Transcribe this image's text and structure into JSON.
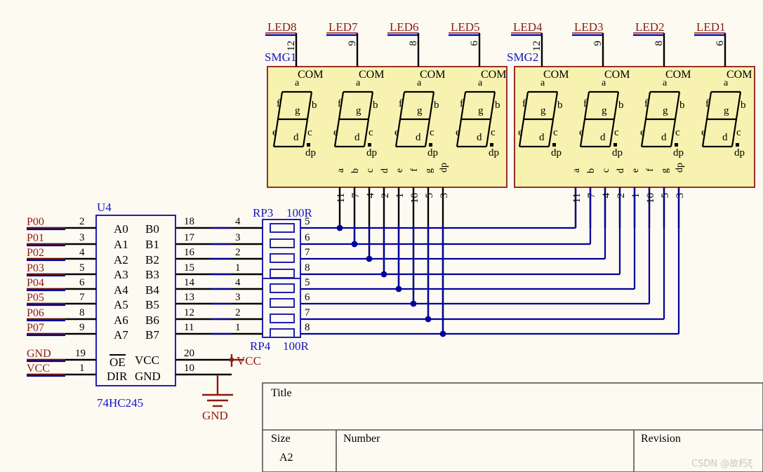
{
  "sheet": {
    "background": "#fdfaf2",
    "wire_color": "#00009f",
    "pin_color": "#000000",
    "net_label_color": "#8b1a10",
    "designator_color": "#1414c8",
    "display_fill": "#f7f2b0",
    "display_border": "#8b1a10"
  },
  "displays": [
    {
      "designator": "SMG1",
      "digits": [
        {
          "net": "LED8",
          "com_pin": "12",
          "com_label": "COM"
        },
        {
          "net": "LED7",
          "com_pin": "9",
          "com_label": "COM"
        },
        {
          "net": "LED6",
          "com_pin": "8",
          "com_label": "COM"
        },
        {
          "net": "LED5",
          "com_pin": "6",
          "com_label": "COM"
        }
      ],
      "segment_labels": [
        "a",
        "b",
        "c",
        "d",
        "e",
        "f",
        "g",
        "dp"
      ],
      "bottom_pins": [
        {
          "seg": "a",
          "pin": "11"
        },
        {
          "seg": "b",
          "pin": "7"
        },
        {
          "seg": "c",
          "pin": "4"
        },
        {
          "seg": "d",
          "pin": "2"
        },
        {
          "seg": "e",
          "pin": "1"
        },
        {
          "seg": "f",
          "pin": "10"
        },
        {
          "seg": "g",
          "pin": "5"
        },
        {
          "seg": "dp",
          "pin": "3"
        }
      ]
    },
    {
      "designator": "SMG2",
      "digits": [
        {
          "net": "LED4",
          "com_pin": "12",
          "com_label": "COM"
        },
        {
          "net": "LED3",
          "com_pin": "9",
          "com_label": "COM"
        },
        {
          "net": "LED2",
          "com_pin": "8",
          "com_label": "COM"
        },
        {
          "net": "LED1",
          "com_pin": "6",
          "com_label": "COM"
        }
      ],
      "segment_labels": [
        "a",
        "b",
        "c",
        "d",
        "e",
        "f",
        "g",
        "dp"
      ],
      "bottom_pins": [
        {
          "seg": "a",
          "pin": "11"
        },
        {
          "seg": "b",
          "pin": "7"
        },
        {
          "seg": "c",
          "pin": "4"
        },
        {
          "seg": "d",
          "pin": "2"
        },
        {
          "seg": "e",
          "pin": "1"
        },
        {
          "seg": "f",
          "pin": "10"
        },
        {
          "seg": "g",
          "pin": "5"
        },
        {
          "seg": "dp",
          "pin": "3"
        }
      ]
    }
  ],
  "ic": {
    "designator": "U4",
    "part_number": "74HC245",
    "left_rows": [
      {
        "net": "P00",
        "pin": "2",
        "name": "A0"
      },
      {
        "net": "P01",
        "pin": "3",
        "name": "A1"
      },
      {
        "net": "P02",
        "pin": "4",
        "name": "A2"
      },
      {
        "net": "P03",
        "pin": "5",
        "name": "A3"
      },
      {
        "net": "P04",
        "pin": "6",
        "name": "A4"
      },
      {
        "net": "P05",
        "pin": "7",
        "name": "A5"
      },
      {
        "net": "P06",
        "pin": "8",
        "name": "A6"
      },
      {
        "net": "P07",
        "pin": "9",
        "name": "A7"
      }
    ],
    "right_rows": [
      {
        "pin": "18",
        "name": "B0"
      },
      {
        "pin": "17",
        "name": "B1"
      },
      {
        "pin": "16",
        "name": "B2"
      },
      {
        "pin": "15",
        "name": "B3"
      },
      {
        "pin": "14",
        "name": "B4"
      },
      {
        "pin": "13",
        "name": "B5"
      },
      {
        "pin": "12",
        "name": "B6"
      },
      {
        "pin": "11",
        "name": "B7"
      }
    ],
    "power_left": [
      {
        "net": "GND",
        "pin": "19",
        "name": "OE",
        "overbar": true
      },
      {
        "net": "VCC",
        "pin": "1",
        "name": "DIR",
        "overbar": false
      }
    ],
    "power_right": [
      {
        "pin": "20",
        "name": "VCC"
      },
      {
        "pin": "10",
        "name": "GND"
      }
    ]
  },
  "resistor_networks": [
    {
      "designator": "RP3",
      "value": "100R",
      "elements": [
        {
          "left_pin": "4",
          "right_pin": "5"
        },
        {
          "left_pin": "3",
          "right_pin": "6"
        },
        {
          "left_pin": "2",
          "right_pin": "7"
        },
        {
          "left_pin": "1",
          "right_pin": "8"
        }
      ]
    },
    {
      "designator": "RP4",
      "value": "100R",
      "elements": [
        {
          "left_pin": "4",
          "right_pin": "5"
        },
        {
          "left_pin": "3",
          "right_pin": "6"
        },
        {
          "left_pin": "2",
          "right_pin": "7"
        },
        {
          "left_pin": "1",
          "right_pin": "8"
        }
      ]
    }
  ],
  "power_symbols": {
    "vcc_label": "VCC",
    "gnd_label": "GND"
  },
  "title_block": {
    "title_label": "Title",
    "title_value": "",
    "size_label": "Size",
    "size_value": "A2",
    "number_label": "Number",
    "number_value": "",
    "revision_label": "Revision",
    "revision_value": ""
  },
  "watermark": "CSDN @故朽ξ"
}
